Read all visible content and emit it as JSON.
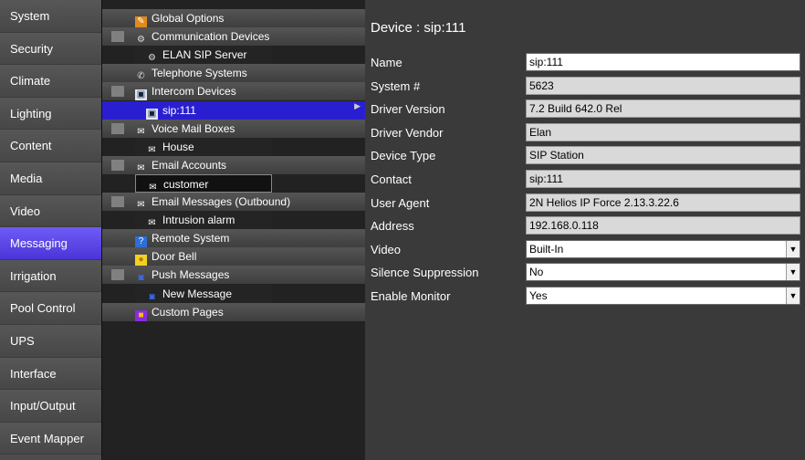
{
  "nav": {
    "items": [
      "System",
      "Security",
      "Climate",
      "Lighting",
      "Content",
      "Media",
      "Video",
      "Messaging",
      "Irrigation",
      "Pool Control",
      "UPS",
      "Interface",
      "Input/Output",
      "Event Mapper"
    ],
    "active_index": 7
  },
  "tree": {
    "items": [
      {
        "label": "Global Options",
        "indent": 0,
        "expander": false,
        "icon": "gear-icon"
      },
      {
        "label": "Communication Devices",
        "indent": 0,
        "expander": true,
        "icon": "network-icon"
      },
      {
        "label": "ELAN SIP Server",
        "indent": 1,
        "expander": false,
        "icon": "network-icon"
      },
      {
        "label": "Telephone Systems",
        "indent": 0,
        "expander": false,
        "icon": "phone-icon"
      },
      {
        "label": "Intercom Devices",
        "indent": 0,
        "expander": true,
        "icon": "intercom-icon"
      },
      {
        "label": "sip:111",
        "indent": 1,
        "expander": false,
        "icon": "intercom-icon",
        "selected": true
      },
      {
        "label": "Voice Mail Boxes",
        "indent": 0,
        "expander": true,
        "icon": "envelope-icon"
      },
      {
        "label": "House",
        "indent": 1,
        "expander": false,
        "icon": "envelope-icon"
      },
      {
        "label": "Email Accounts",
        "indent": 0,
        "expander": true,
        "icon": "envelope-icon"
      },
      {
        "label": "customer",
        "indent": 1,
        "expander": false,
        "icon": "envelope-icon",
        "highlight": true
      },
      {
        "label": "Email Messages (Outbound)",
        "indent": 0,
        "expander": true,
        "icon": "envelope-icon"
      },
      {
        "label": "Intrusion alarm",
        "indent": 1,
        "expander": false,
        "icon": "envelope-icon"
      },
      {
        "label": "Remote System",
        "indent": 0,
        "expander": false,
        "icon": "question-icon"
      },
      {
        "label": "Door Bell",
        "indent": 0,
        "expander": false,
        "icon": "bell-icon"
      },
      {
        "label": "Push Messages",
        "indent": 0,
        "expander": true,
        "icon": "push-icon"
      },
      {
        "label": "New Message",
        "indent": 1,
        "expander": false,
        "icon": "push-icon"
      },
      {
        "label": "Custom Pages",
        "indent": 0,
        "expander": false,
        "icon": "pages-icon"
      }
    ],
    "expander_symbol": "—"
  },
  "detail": {
    "title": "Device : sip:111",
    "fields": [
      {
        "label": "Name",
        "value": "sip:111",
        "kind": "rw"
      },
      {
        "label": "System #",
        "value": "5623",
        "kind": "ro"
      },
      {
        "label": "Driver Version",
        "value": "7.2 Build 642.0 Rel",
        "kind": "ro"
      },
      {
        "label": "Driver Vendor",
        "value": "Elan",
        "kind": "ro"
      },
      {
        "label": "Device Type",
        "value": "SIP Station",
        "kind": "ro"
      },
      {
        "label": "Contact",
        "value": "sip:111",
        "kind": "ro"
      },
      {
        "label": "User Agent",
        "value": "2N Helios IP Force 2.13.3.22.6",
        "kind": "ro"
      },
      {
        "label": "Address",
        "value": "192.168.0.118",
        "kind": "ro"
      },
      {
        "label": "Video",
        "value": "Built-In",
        "kind": "dropdown"
      },
      {
        "label": "Silence Suppression",
        "value": "No",
        "kind": "dropdown"
      },
      {
        "label": "Enable Monitor",
        "value": "Yes",
        "kind": "dropdown"
      }
    ]
  },
  "colors": {
    "active_nav": "#5b46e8",
    "tree_selected": "#2a1fd0"
  }
}
